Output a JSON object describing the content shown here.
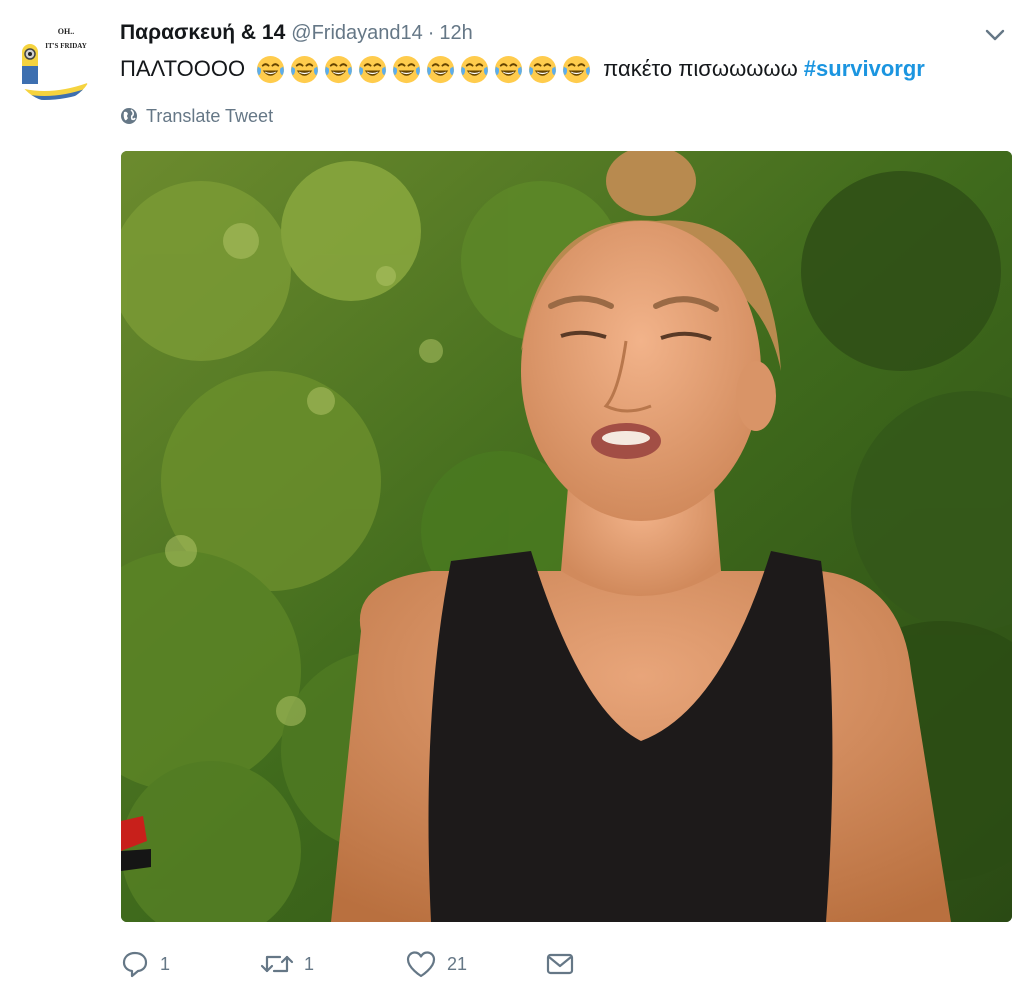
{
  "avatar": {
    "line1": "OH..",
    "line2": "IT'S FRIDAY"
  },
  "header": {
    "display_name": "Παρασκευή & 14",
    "handle": "@Fridayand14",
    "separator": "·",
    "time": "12h"
  },
  "tweet": {
    "text_before": "ΠΑΛΤΟΟΟΟ",
    "emoji_name": "face-with-tears-of-joy-icon",
    "emoji_count": 10,
    "text_after": "πακέτο πισωωωωω",
    "hashtag": "#survivorgr"
  },
  "translate_label": "Translate Tweet",
  "actions": {
    "reply_count": "1",
    "retweet_count": "1",
    "like_count": "21"
  },
  "colors": {
    "link": "#1b95e0",
    "secondary_text": "#657786",
    "primary_text": "#14171a"
  }
}
